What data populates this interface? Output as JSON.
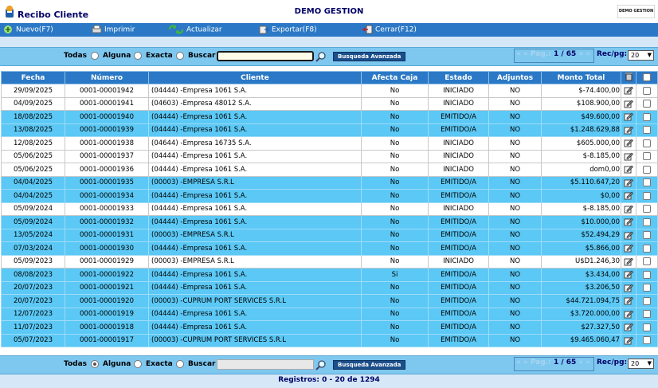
{
  "app": {
    "title": "Recibo Cliente",
    "center_title": "DEMO GESTION",
    "logo_text": "DEMO GESTION"
  },
  "toolbar": {
    "nuevo": "Nuevo(F7)",
    "imprimir": "Imprimir",
    "actualizar": "Actualizar",
    "exportar": "Exportar(F8)",
    "cerrar": "Cerrar(F12)"
  },
  "search_top": {
    "todas": "Todas",
    "alguna": "Alguna",
    "exacta": "Exacta",
    "buscar": "Buscar",
    "value": "",
    "advanced": "Busqueda Avanzada",
    "pager_prefix": "« « Pag.:",
    "page": "1 / 65",
    "pager_suffix": "» »",
    "rec_label": "Rec/pg:",
    "rec_value": "20",
    "selected": "none"
  },
  "search_bottom": {
    "todas": "Todas",
    "alguna": "Alguna",
    "exacta": "Exacta",
    "buscar": "Buscar",
    "value": "",
    "advanced": "Busqueda Avanzada",
    "pager_prefix": "« « Pag.:",
    "page": "1 / 65",
    "pager_suffix": "» »",
    "rec_label": "Rec/pg:",
    "rec_value": "20",
    "selected": "todas"
  },
  "table": {
    "headers": [
      "Fecha",
      "Número",
      "Cliente",
      "Afecta Caja",
      "Estado",
      "Adjuntos",
      "Monto Total"
    ],
    "rows": [
      {
        "fecha": "29/09/2025",
        "numero": "0001-00001942",
        "cliente": "(04444) -Empresa 1061 S.A.",
        "caja": "No",
        "estado": "INICIADO",
        "adjuntos": "NO",
        "monto": "$-74.400,00",
        "style": "white"
      },
      {
        "fecha": "04/09/2025",
        "numero": "0001-00001941",
        "cliente": "(04603) -Empresa 48012 S.A.",
        "caja": "No",
        "estado": "INICIADO",
        "adjuntos": "NO",
        "monto": "$108.900,00",
        "style": "white"
      },
      {
        "fecha": "18/08/2025",
        "numero": "0001-00001940",
        "cliente": "(04444) -Empresa 1061 S.A.",
        "caja": "No",
        "estado": "EMITIDO/A",
        "adjuntos": "NO",
        "monto": "$49.600,00",
        "style": "blue"
      },
      {
        "fecha": "13/08/2025",
        "numero": "0001-00001939",
        "cliente": "(04444) -Empresa 1061 S.A.",
        "caja": "No",
        "estado": "EMITIDO/A",
        "adjuntos": "NO",
        "monto": "$1.248.629,88",
        "style": "blue"
      },
      {
        "fecha": "12/08/2025",
        "numero": "0001-00001938",
        "cliente": "(04644) -Empresa 16735 S.A.",
        "caja": "No",
        "estado": "INICIADO",
        "adjuntos": "NO",
        "monto": "$605.000,00",
        "style": "white"
      },
      {
        "fecha": "05/06/2025",
        "numero": "0001-00001937",
        "cliente": "(04444) -Empresa 1061 S.A.",
        "caja": "No",
        "estado": "INICIADO",
        "adjuntos": "NO",
        "monto": "$-8.185,00",
        "style": "white"
      },
      {
        "fecha": "05/06/2025",
        "numero": "0001-00001936",
        "cliente": "(04444) -Empresa 1061 S.A.",
        "caja": "No",
        "estado": "INICIADO",
        "adjuntos": "NO",
        "monto": "dom0,00",
        "style": "white"
      },
      {
        "fecha": "04/04/2025",
        "numero": "0001-00001935",
        "cliente": "(00003) -EMPRESA S.R.L",
        "caja": "No",
        "estado": "EMITIDO/A",
        "adjuntos": "NO",
        "monto": "$5.110.647,20",
        "style": "blue"
      },
      {
        "fecha": "04/04/2025",
        "numero": "0001-00001934",
        "cliente": "(04444) -Empresa 1061 S.A.",
        "caja": "No",
        "estado": "EMITIDO/A",
        "adjuntos": "NO",
        "monto": "$0,00",
        "style": "blue"
      },
      {
        "fecha": "05/09/2024",
        "numero": "0001-00001933",
        "cliente": "(04444) -Empresa 1061 S.A.",
        "caja": "No",
        "estado": "INICIADO",
        "adjuntos": "NO",
        "monto": "$-8.185,00",
        "style": "white"
      },
      {
        "fecha": "05/09/2024",
        "numero": "0001-00001932",
        "cliente": "(04444) -Empresa 1061 S.A.",
        "caja": "No",
        "estado": "EMITIDO/A",
        "adjuntos": "NO",
        "monto": "$10.000,00",
        "style": "blue"
      },
      {
        "fecha": "13/05/2024",
        "numero": "0001-00001931",
        "cliente": "(00003) -EMPRESA S.R.L",
        "caja": "No",
        "estado": "EMITIDO/A",
        "adjuntos": "NO",
        "monto": "$52.494,29",
        "style": "blue"
      },
      {
        "fecha": "07/03/2024",
        "numero": "0001-00001930",
        "cliente": "(04444) -Empresa 1061 S.A.",
        "caja": "No",
        "estado": "EMITIDO/A",
        "adjuntos": "NO",
        "monto": "$5.866,00",
        "style": "blue"
      },
      {
        "fecha": "05/09/2023",
        "numero": "0001-00001929",
        "cliente": "(00003) -EMPRESA S.R.L",
        "caja": "No",
        "estado": "INICIADO",
        "adjuntos": "NO",
        "monto": "U$D1.246,30",
        "style": "white"
      },
      {
        "fecha": "08/08/2023",
        "numero": "0001-00001922",
        "cliente": "(04444) -Empresa 1061 S.A.",
        "caja": "Si",
        "estado": "EMITIDO/A",
        "adjuntos": "NO",
        "monto": "$3.434,00",
        "style": "blue"
      },
      {
        "fecha": "20/07/2023",
        "numero": "0001-00001921",
        "cliente": "(04444) -Empresa 1061 S.A.",
        "caja": "No",
        "estado": "EMITIDO/A",
        "adjuntos": "NO",
        "monto": "$3.206,50",
        "style": "blue"
      },
      {
        "fecha": "20/07/2023",
        "numero": "0001-00001920",
        "cliente": "(00003) -CUPRUM PORT SERVICES S.R.L",
        "caja": "No",
        "estado": "EMITIDO/A",
        "adjuntos": "NO",
        "monto": "$44.721.094,75",
        "style": "blue"
      },
      {
        "fecha": "12/07/2023",
        "numero": "0001-00001919",
        "cliente": "(04444) -Empresa 1061 S.A.",
        "caja": "No",
        "estado": "EMITIDO/A",
        "adjuntos": "NO",
        "monto": "$3.720.000,00",
        "style": "blue"
      },
      {
        "fecha": "11/07/2023",
        "numero": "0001-00001918",
        "cliente": "(04444) -Empresa 1061 S.A.",
        "caja": "No",
        "estado": "EMITIDO/A",
        "adjuntos": "NO",
        "monto": "$27.327,50",
        "style": "blue"
      },
      {
        "fecha": "05/07/2023",
        "numero": "0001-00001917",
        "cliente": "(00003) -CUPRUM PORT SERVICES S.R.L",
        "caja": "No",
        "estado": "EMITIDO/A",
        "adjuntos": "NO",
        "monto": "$9.465.060,47",
        "style": "blue"
      }
    ]
  },
  "footer": {
    "registros": "Registros: 0 - 20 de 1294"
  },
  "colors": {
    "toolbar": "#2b79c6",
    "row_blue": "#5bc8f5",
    "header": "#2b79c6",
    "searchbar": "#7ec8f0"
  }
}
